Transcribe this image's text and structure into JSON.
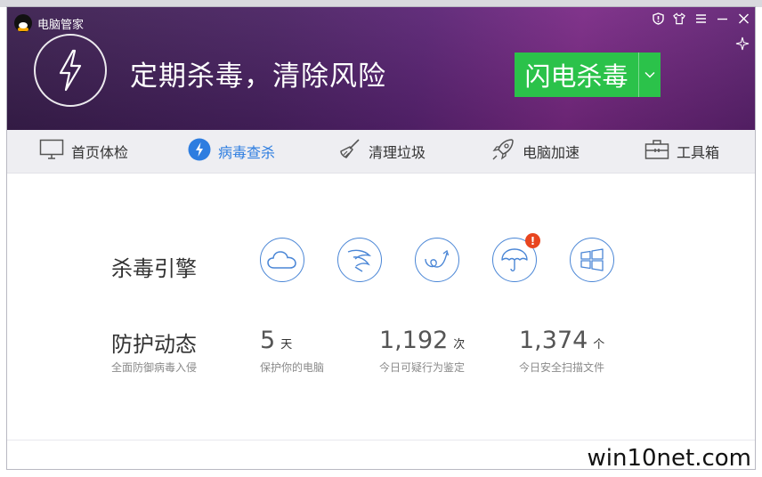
{
  "app": {
    "title": "电脑管家"
  },
  "header": {
    "headline": "定期杀毒，清除风险",
    "scan_button_label": "闪电杀毒"
  },
  "window_controls": [
    "shield-icon",
    "skin-icon",
    "menu-icon",
    "minimize-icon",
    "close-icon"
  ],
  "nav": {
    "items": [
      {
        "label": "首页体检",
        "icon": "monitor-icon"
      },
      {
        "label": "病毒查杀",
        "icon": "bolt-icon",
        "active": true
      },
      {
        "label": "清理垃圾",
        "icon": "broom-icon"
      },
      {
        "label": "电脑加速",
        "icon": "rocket-icon"
      },
      {
        "label": "工具箱",
        "icon": "toolbox-icon"
      }
    ]
  },
  "engines": {
    "label": "杀毒引擎",
    "icons": [
      "cloud-icon",
      "feather-icon",
      "swirl-arrow-icon",
      "umbrella-icon",
      "windows-icon"
    ],
    "alert_badge": "!"
  },
  "protection": {
    "label": "防护动态",
    "sublabel": "全面防御病毒入侵",
    "stats": [
      {
        "value": "5",
        "unit": "天",
        "caption": "保护你的电脑"
      },
      {
        "value": "1,192",
        "unit": "次",
        "caption": "今日可疑行为鉴定"
      },
      {
        "value": "1,374",
        "unit": "个",
        "caption": "今日安全扫描文件"
      }
    ]
  },
  "watermark": "win10net.com",
  "colors": {
    "accent": "#2d7de0",
    "scan_green": "#2bc24a",
    "header_purple": "#5b2475",
    "badge_red": "#e8451f"
  }
}
